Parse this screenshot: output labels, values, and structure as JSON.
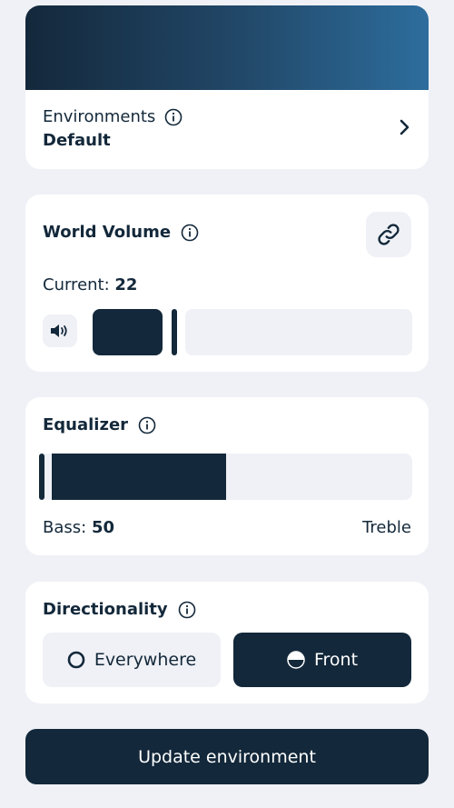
{
  "environments": {
    "label": "Environments",
    "value": "Default"
  },
  "world_volume": {
    "title": "World Volume",
    "current_label": "Current:",
    "current_value": "22",
    "level": 0.22
  },
  "equalizer": {
    "title": "Equalizer",
    "bass_label": "Bass:",
    "bass_value": "50",
    "treble_label": "Treble",
    "level": 0.5
  },
  "directionality": {
    "title": "Directionality",
    "options": [
      {
        "label": "Everywhere",
        "selected": false
      },
      {
        "label": "Front",
        "selected": true
      }
    ]
  },
  "update_button_label": "Update environment",
  "colors": {
    "primary": "#13283a",
    "background": "#eff1f6",
    "card": "#ffffff"
  },
  "icons": {
    "info": "info-icon",
    "chevron": "chevron-right-icon",
    "link": "link-icon",
    "speaker": "speaker-icon",
    "radio_empty": "radio-empty-icon",
    "radio_half": "radio-half-icon"
  }
}
